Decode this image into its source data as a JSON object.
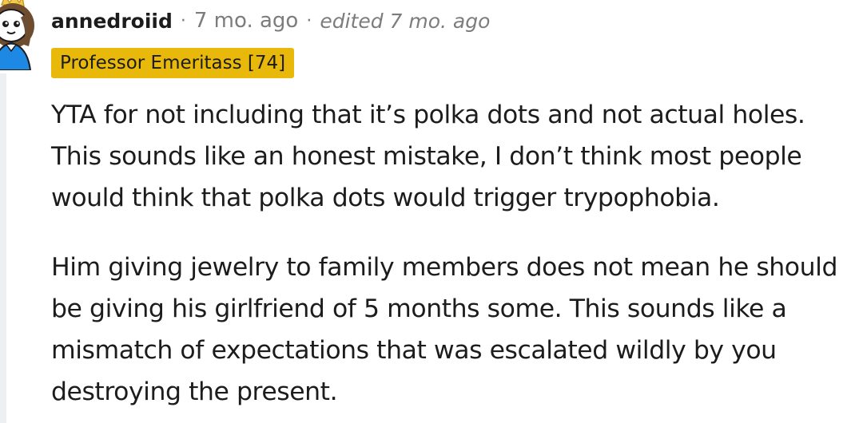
{
  "comment": {
    "author": "annedroiid",
    "separator": "·",
    "timestamp": "7 mo. ago",
    "edited": "edited 7 mo. ago",
    "flair": "Professor Emeritass [74]",
    "paragraphs": [
      "YTA for not including that it’s polka dots and not actual holes. This sounds like an honest mistake, I don’t think most people would think that polka dots would trigger trypophobia.",
      "Him giving jewelry to family members does not mean he should be giving his girlfriend of 5 months some. This sounds like a mismatch of expectations that was escalated wildly by you destroying the present."
    ]
  },
  "icons": {
    "avatar": "snoo-avatar-icon"
  },
  "colors": {
    "flair_background": "#e8b90a",
    "meta_text": "#7c7c7c",
    "body_text": "#1c1c1c",
    "thread_line": "#edeff1",
    "avatar_shirt": "#1e88e5",
    "avatar_hair": "#6d4c2f",
    "avatar_crown": "#f2c94c"
  }
}
